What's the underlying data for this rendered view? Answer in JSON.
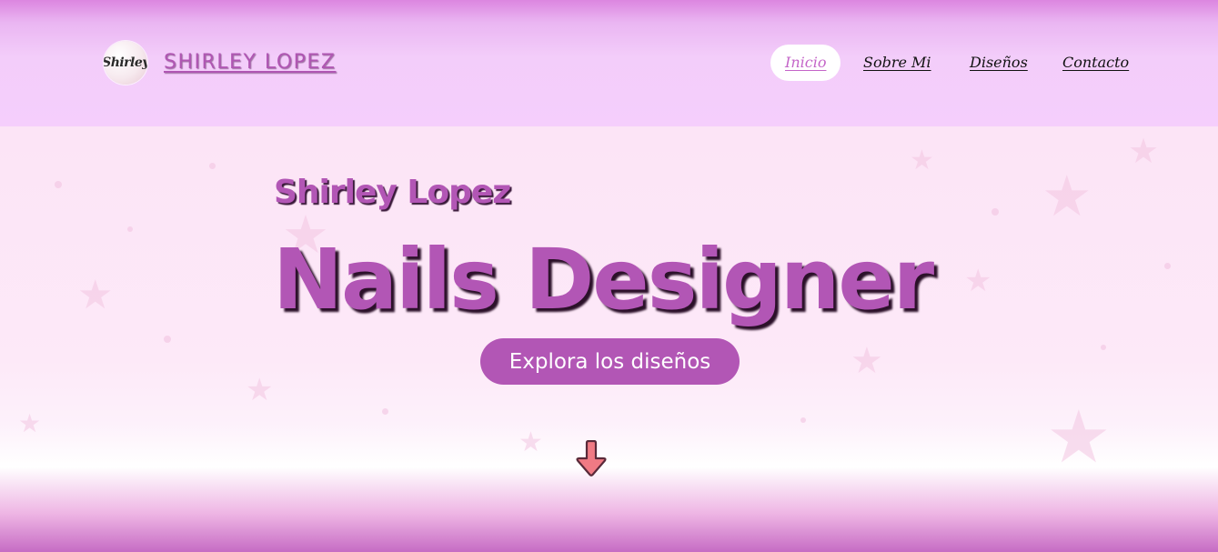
{
  "header": {
    "logo_text": "Shirley",
    "brand": "SHIRLEY LOPEZ",
    "nav": [
      {
        "label": "Inicio",
        "active": true
      },
      {
        "label": "Sobre Mi",
        "active": false
      },
      {
        "label": "Diseños",
        "active": false
      },
      {
        "label": "Contacto",
        "active": false
      }
    ]
  },
  "hero": {
    "subtitle": "Shirley Lopez",
    "title": "Nails Designer",
    "cta_label": "Explora los diseños",
    "scroll_icon": "arrow-down-icon"
  },
  "colors": {
    "accent": "#b256b5",
    "header_bg": "#f5cefc",
    "active_nav_text": "#c465c8",
    "arrow": "#f07a84"
  }
}
